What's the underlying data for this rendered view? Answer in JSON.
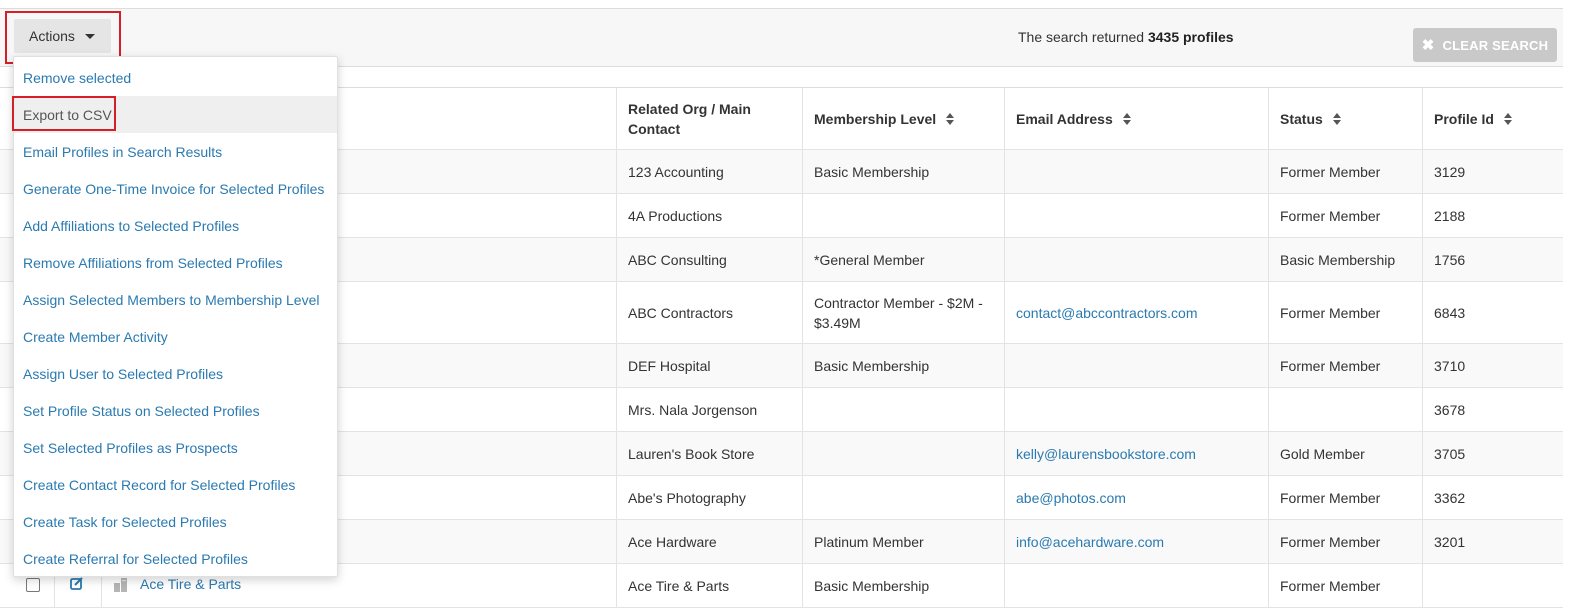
{
  "toolbar": {
    "actions_label": "Actions",
    "search_prefix": "The search returned",
    "search_count": "3435 profiles",
    "clear_label": "CLEAR SEARCH"
  },
  "menu": {
    "items": [
      {
        "label": "Remove selected"
      },
      {
        "label": "Export to CSV"
      },
      {
        "label": "Email Profiles in Search Results"
      },
      {
        "label": "Generate One-Time Invoice for Selected Profiles"
      },
      {
        "label": "Add Affiliations to Selected Profiles"
      },
      {
        "label": "Remove Affiliations from Selected Profiles"
      },
      {
        "label": "Assign Selected Members to Membership Level"
      },
      {
        "label": "Create Member Activity"
      },
      {
        "label": "Assign User to Selected Profiles"
      },
      {
        "label": "Set Profile Status on Selected Profiles"
      },
      {
        "label": "Set Selected Profiles as Prospects"
      },
      {
        "label": "Create Contact Record for Selected Profiles"
      },
      {
        "label": "Create Task for Selected Profiles"
      },
      {
        "label": "Create Referral for Selected Profiles"
      }
    ]
  },
  "table": {
    "headers": {
      "org": "Related Org / Main Contact",
      "level": "Membership Level",
      "email": "Email Address",
      "status": "Status",
      "profile_id": "Profile Id"
    },
    "rows": [
      {
        "org": "123 Accounting",
        "level": "Basic Membership",
        "email": "",
        "status": "Former Member",
        "profile_id": "3129"
      },
      {
        "org": "4A Productions",
        "level": "",
        "email": "",
        "status": "Former Member",
        "profile_id": "2188"
      },
      {
        "org": "ABC Consulting",
        "level": "*General Member",
        "email": "",
        "status": "Basic Membership",
        "profile_id": "1756"
      },
      {
        "org": "ABC Contractors",
        "level": "Contractor Member - $2M - $3.49M",
        "email": "contact@abccontractors.com",
        "status": "Former Member",
        "profile_id": "6843"
      },
      {
        "org": "DEF Hospital",
        "level": "Basic Membership",
        "email": "",
        "status": "Former Member",
        "profile_id": "3710"
      },
      {
        "org": "Mrs. Nala Jorgenson",
        "level": "",
        "email": "",
        "status": "",
        "profile_id": "3678"
      },
      {
        "org": "Lauren's Book Store",
        "level": "",
        "email": "kelly@laurensbookstore.com",
        "status": "Gold Member",
        "profile_id": "3705"
      },
      {
        "org": "Abe's Photography",
        "level": "",
        "email": "abe@photos.com",
        "status": "Former Member",
        "profile_id": "3362"
      },
      {
        "org": "Ace Hardware",
        "level": "Platinum Member",
        "email": "info@acehardware.com",
        "status": "Former Member",
        "profile_id": "3201"
      },
      {
        "org": "Ace Tire & Parts",
        "level": "Basic Membership",
        "email": "",
        "status": "Former Member",
        "profile_id": "",
        "name": "Ace Tire & Parts"
      }
    ]
  },
  "colors": {
    "link": "#2a7ab0",
    "highlight": "#d32027",
    "clear_button": "#c9c9c9"
  }
}
